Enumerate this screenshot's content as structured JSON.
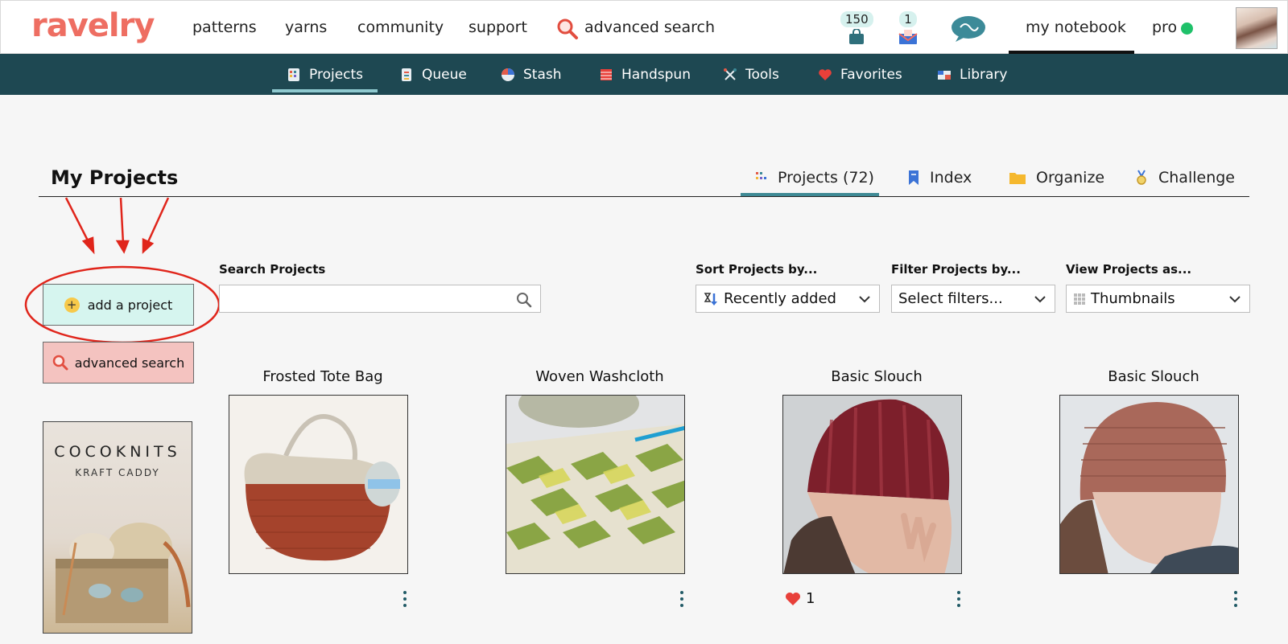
{
  "header": {
    "logo": "ravelry",
    "nav": [
      "patterns",
      "yarns",
      "community",
      "support"
    ],
    "advanced_search": "advanced search",
    "cart_count": "150",
    "mail_count": "1",
    "my_notebook": "my notebook",
    "pro": "pro"
  },
  "subnav": [
    {
      "label": "Projects",
      "icon": "projects-icon",
      "active": true
    },
    {
      "label": "Queue",
      "icon": "queue-icon"
    },
    {
      "label": "Stash",
      "icon": "stash-icon"
    },
    {
      "label": "Handspun",
      "icon": "handspun-icon"
    },
    {
      "label": "Tools",
      "icon": "tools-icon"
    },
    {
      "label": "Favorites",
      "icon": "heart-icon"
    },
    {
      "label": "Library",
      "icon": "library-icon"
    }
  ],
  "page": {
    "title": "My Projects",
    "tabs": [
      {
        "label": "Projects (72)",
        "active": true
      },
      {
        "label": "Index"
      },
      {
        "label": "Organize"
      },
      {
        "label": "Challenge"
      }
    ]
  },
  "sidebar": {
    "add_project": "add a project",
    "advanced_search": "advanced search",
    "ad_brand": "COCOKNITS",
    "ad_subtitle": "KRAFT CADDY"
  },
  "controls": {
    "search_label": "Search Projects",
    "search_value": "",
    "sort_label": "Sort Projects by...",
    "sort_value": "Recently added",
    "filter_label": "Filter Projects by...",
    "filter_value": "Select filters...",
    "view_label": "View Projects as...",
    "view_value": "Thumbnails"
  },
  "projects": [
    {
      "title": "Frosted Tote Bag",
      "favorites": null
    },
    {
      "title": "Woven Washcloth",
      "favorites": null
    },
    {
      "title": "Basic Slouch",
      "favorites": "1"
    },
    {
      "title": "Basic Slouch",
      "favorites": null
    }
  ],
  "colors": {
    "brand": "#ee6e62",
    "subnav_bg": "#1e4852",
    "add_button_bg": "#d6f5ef",
    "advanced_button_bg": "#f4c3c0",
    "annotation_red": "#e0251b"
  }
}
